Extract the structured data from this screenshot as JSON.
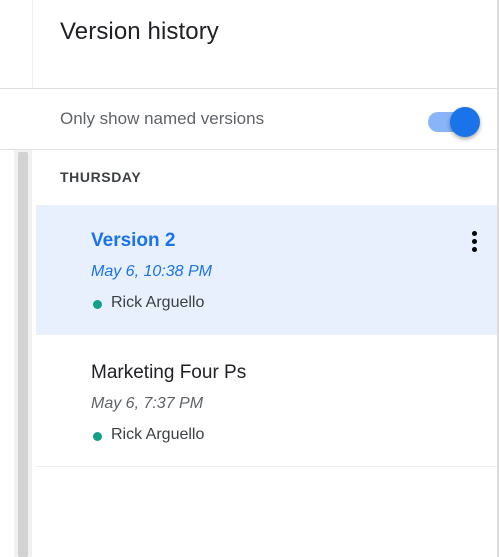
{
  "panel": {
    "title": "Version history"
  },
  "filter": {
    "label": "Only show named versions",
    "enabled": true
  },
  "groups": [
    {
      "label": "THURSDAY",
      "versions": [
        {
          "name": "Version 2",
          "date": "May 6, 10:38 PM",
          "author": "Rick Arguello",
          "selected": true
        },
        {
          "name": "Marketing Four Ps",
          "date": "May 6, 7:37 PM",
          "author": "Rick Arguello",
          "selected": false
        }
      ]
    }
  ],
  "colors": {
    "accent": "#1a73e8",
    "toggle_track": "#8ab4f8",
    "selected_background": "#e8f0fe",
    "author_dot": "#12a089"
  },
  "icons": {
    "more": "more-vert-icon"
  }
}
